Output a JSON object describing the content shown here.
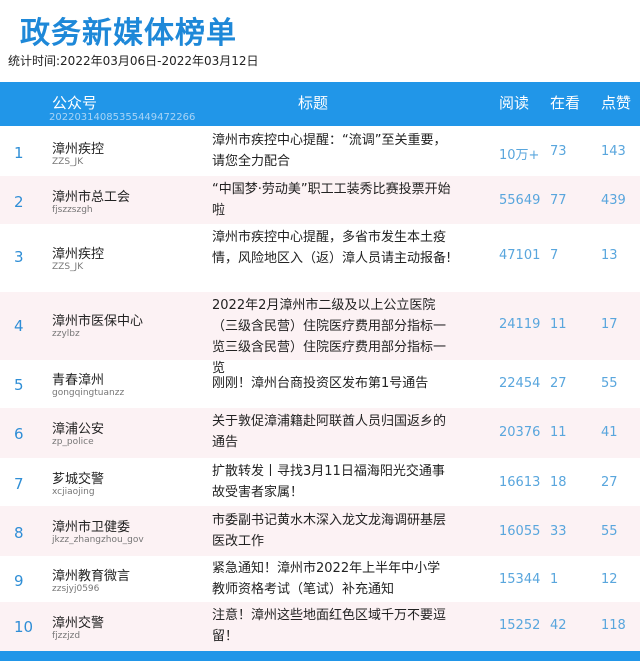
{
  "page_title": "政务新媒体榜单",
  "stat_period": "统计时间:2022年03月06日-2022年03月12日",
  "table": {
    "headers": {
      "account": "公众号",
      "title": "标题",
      "read": "阅读",
      "watch": "在看",
      "like": "点赞",
      "sub": "20220314085355449472266"
    },
    "rows": [
      {
        "rank": "1",
        "name": "漳州疾控",
        "id": "ZZS_JK",
        "title": "漳州市疾控中心提醒：“流调”至关重要，请您全力配合",
        "read": "10万+",
        "watch": "73",
        "like": "143"
      },
      {
        "rank": "2",
        "name": "漳州市总工会",
        "id": "fjszzszgh",
        "title": "“中国梦·劳动美”职工工装秀比赛投票开始啦",
        "read": "55649",
        "watch": "77",
        "like": "439"
      },
      {
        "rank": "3",
        "name": "漳州疾控",
        "id": "ZZS_JK",
        "title": "漳州市疾控中心提醒，多省市发生本土疫情，风险地区入（返）漳人员请主动报备!",
        "read": "47101",
        "watch": "7",
        "like": "13"
      },
      {
        "rank": "4",
        "name": "漳州市医保中心",
        "id": "zzylbz",
        "title": "2022年2月漳州市二级及以上公立医院（三级含民营）住院医疗费用部分指标一览三级含民营）住院医疗费用部分指标一览",
        "read": "24119",
        "watch": "11",
        "like": "17"
      },
      {
        "rank": "5",
        "name": "青春漳州",
        "id": "gongqingtuanzz",
        "title": "刚刚！漳州台商投资区发布第1号通告",
        "read": "22454",
        "watch": "27",
        "like": "55"
      },
      {
        "rank": "6",
        "name": "漳浦公安",
        "id": "zp_police",
        "title": "关于敦促漳浦籍赴阿联酋人员归国返乡的通告",
        "read": "20376",
        "watch": "11",
        "like": "41"
      },
      {
        "rank": "7",
        "name": "芗城交警",
        "id": "xcjiaojing",
        "title": "扩散转发丨寻找3月11日福海阳光交通事故受害者家属！",
        "read": "16613",
        "watch": "18",
        "like": "27"
      },
      {
        "rank": "8",
        "name": "漳州市卫健委",
        "id": "jkzz_zhangzhou_gov",
        "title": "市委副书记黄水木深入龙文龙海调研基层医改工作",
        "read": "16055",
        "watch": "33",
        "like": "55"
      },
      {
        "rank": "9",
        "name": "漳州教育微言",
        "id": "zzsjyj0596",
        "title": "紧急通知！漳州市2022年上半年中小学教师资格考试（笔试）补充通知",
        "read": "15344",
        "watch": "1",
        "like": "12"
      },
      {
        "rank": "10",
        "name": "漳州交警",
        "id": "fjzzjzd",
        "title": "注意！漳州这些地面红色区域千万不要逗留！",
        "read": "15252",
        "watch": "42",
        "like": "118"
      }
    ]
  },
  "colors": {
    "accent": "#2196e8",
    "title": "#1e88d8",
    "alt_row": "#fcf2f4",
    "numbers": "#59a6dd"
  }
}
